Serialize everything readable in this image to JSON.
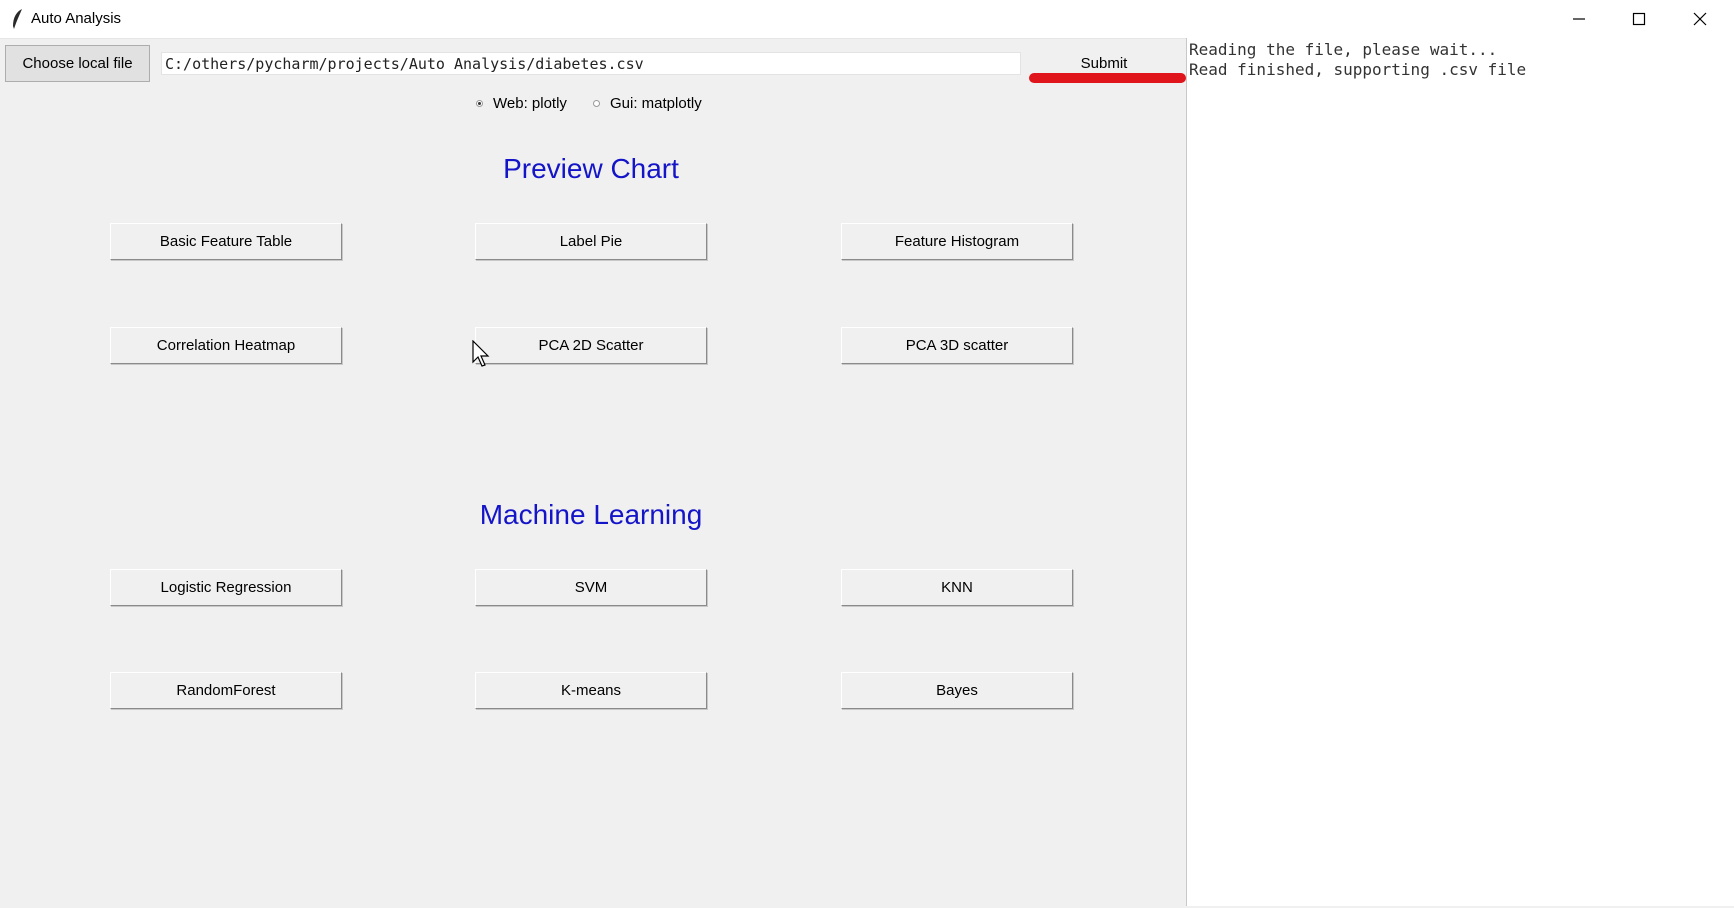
{
  "window": {
    "title": "Auto Analysis",
    "icon": "feather-icon",
    "controls": [
      "minimize-icon",
      "maximize-icon",
      "close-icon"
    ]
  },
  "toolbar": {
    "choose_file_label": "Choose local file",
    "file_path": "C:/others/pycharm/projects/Auto Analysis/diabetes.csv",
    "submit_label": "Submit"
  },
  "mode": {
    "options": [
      {
        "label": "Web: plotly",
        "selected": true
      },
      {
        "label": "Gui: matplotly",
        "selected": false
      }
    ]
  },
  "preview": {
    "heading": "Preview Chart",
    "buttons": [
      "Basic Feature Table",
      "Label Pie",
      "Feature Histogram",
      "Correlation Heatmap",
      "PCA 2D Scatter",
      "PCA 3D scatter"
    ]
  },
  "ml": {
    "heading": "Machine Learning",
    "buttons": [
      "Logistic Regression",
      "SVM",
      "KNN",
      "RandomForest",
      "K-means",
      "Bayes"
    ]
  },
  "output": {
    "lines": [
      "Reading the file, please wait...",
      "Read finished, supporting .csv file"
    ]
  },
  "colors": {
    "heading": "#1414c8",
    "highlight": "#e0151b",
    "background": "#f0f0f0"
  }
}
